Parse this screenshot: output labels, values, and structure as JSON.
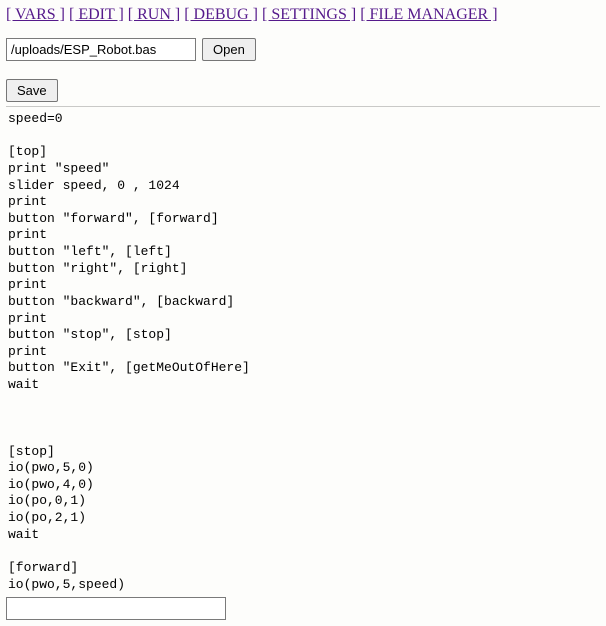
{
  "nav": {
    "vars": "[ VARS ]",
    "edit": "[ EDIT ]",
    "run": "[ RUN ]",
    "debug": "[ DEBUG ]",
    "settings": "[ SETTINGS ]",
    "filemanager": "[ FILE MANAGER ]"
  },
  "file": {
    "path": "/uploads/ESP_Robot.bas",
    "open_label": "Open"
  },
  "actions": {
    "save_label": "Save"
  },
  "code": "speed=0\n\n[top]\nprint \"speed\"\nslider speed, 0 , 1024\nprint\nbutton \"forward\", [forward]\nprint\nbutton \"left\", [left]\nbutton \"right\", [right]\nprint\nbutton \"backward\", [backward]\nprint\nbutton \"stop\", [stop]\nprint\nbutton \"Exit\", [getMeOutOfHere]\nwait\n\n\n\n[stop]\nio(pwo,5,0)\nio(pwo,4,0)\nio(po,0,1)\nio(po,2,1)\nwait\n\n[forward]\nio(pwo,5,speed)",
  "bottom_input": {
    "value": ""
  }
}
